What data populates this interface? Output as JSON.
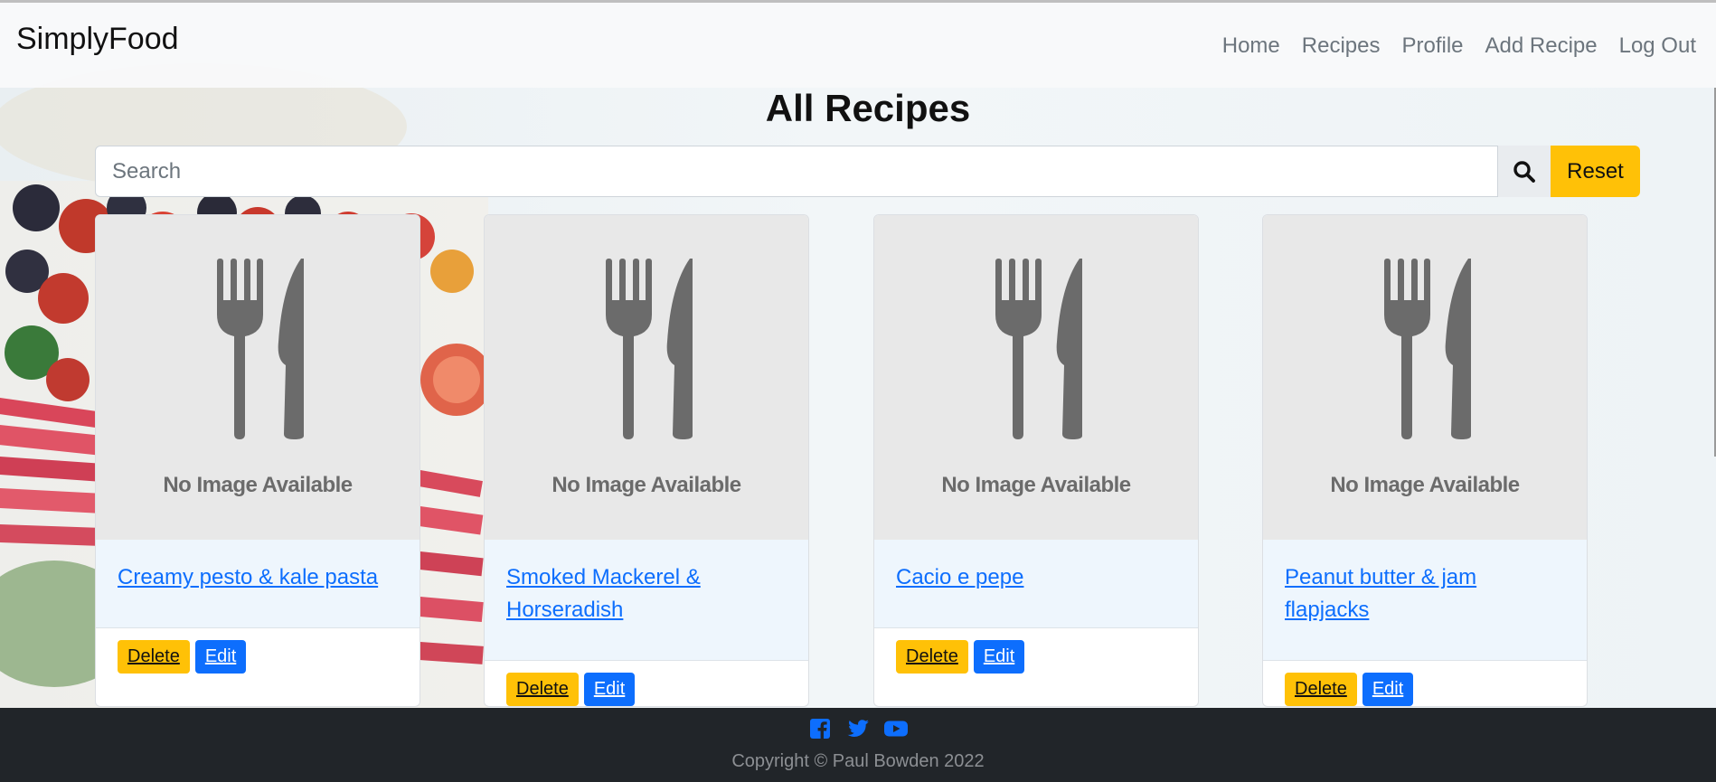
{
  "nav": {
    "brand": "SimplyFood",
    "links": [
      "Home",
      "Recipes",
      "Profile",
      "Add Recipe",
      "Log Out"
    ]
  },
  "page": {
    "title": "All Recipes"
  },
  "search": {
    "placeholder": "Search",
    "value": "",
    "search_icon": "search-icon",
    "reset_label": "Reset"
  },
  "recipes": [
    {
      "title": "Creamy pesto & kale pasta",
      "image_text": "No Image Available",
      "delete_label": "Delete",
      "edit_label": "Edit"
    },
    {
      "title": "Smoked Mackerel & Horseradish",
      "image_text": "No Image Available",
      "delete_label": "Delete",
      "edit_label": "Edit"
    },
    {
      "title": "Cacio e pepe",
      "image_text": "No Image Available",
      "delete_label": "Delete",
      "edit_label": "Edit"
    },
    {
      "title": "Peanut butter & jam flapjacks",
      "image_text": "No Image Available",
      "delete_label": "Delete",
      "edit_label": "Edit"
    }
  ],
  "footer": {
    "social_icons": [
      "facebook-icon",
      "twitter-icon",
      "youtube-icon"
    ],
    "copyright": "Copyright © Paul Bowden 2022"
  },
  "colors": {
    "primary": "#0d6efd",
    "warning": "#ffc107",
    "footer_bg": "#212529",
    "navbar_bg": "#f8f9fa"
  }
}
